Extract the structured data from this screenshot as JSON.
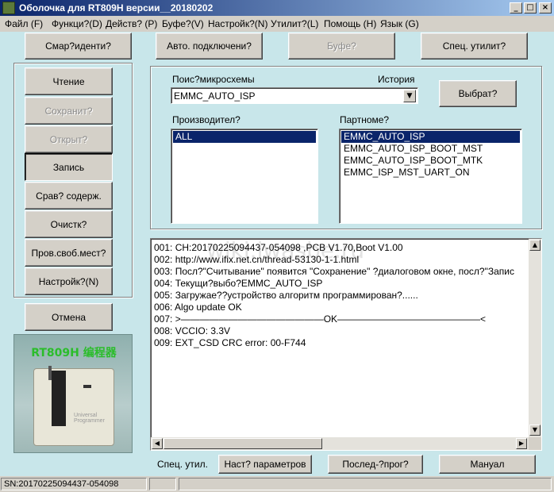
{
  "window": {
    "title": "Оболочка для RT809H версии__20180202",
    "min_symbol": "_",
    "max_symbol": "□",
    "close_symbol": "×"
  },
  "menu": [
    "Файл (F)",
    "Функци?(D)",
    "Действ? (P)",
    "Буфе?(V)",
    "Настройк?(N)",
    "Утилит?(L)",
    "Помощь (H)",
    "Язык (G)"
  ],
  "toolbar": {
    "smart_id": "Смар?иденти?",
    "auto_connect": "Авто. подключени?",
    "buffer": "Буфе?",
    "special_utils": "Спец. утилит?"
  },
  "side_buttons": {
    "read": "Чтение",
    "save": "Сохранит?",
    "open": "Открыт?",
    "write": "Запись",
    "compare": "Срав? содерж.",
    "erase": "Очистк?",
    "check_free": "Пров.своб.мест?",
    "settings": "Настройк?(N)",
    "cancel": "Отмена"
  },
  "device_image": {
    "label": "RT809H 编程器",
    "caption": "Universal Programmer"
  },
  "chip_panel": {
    "search_label": "Поис?микросхемы",
    "history_label": "История",
    "chip_value": "EMMC_AUTO_ISP",
    "select_button": "Выбрат?",
    "manufacturer_label": "Производител?",
    "manufacturers": [
      "ALL"
    ],
    "partnumber_label": "Партноме?",
    "partnumbers": [
      "EMMC_AUTO_ISP",
      "EMMC_AUTO_ISP_BOOT_MST",
      "EMMC_AUTO_ISP_BOOT_MTK",
      "EMMC_ISP_MST_UART_ON"
    ]
  },
  "log": [
    "001:  CH:20170225094437-054098  ,PCB V1.70,Boot V1.00",
    "002:  http://www.ifix.net.cn/thread-53130-1-1.html",
    "003:  Посл?\"Считывание\" появится \"Сохранение\" ?диалоговом окне, посл?\"Запис",
    "004:  Текущи?выбо?EMMC_AUTO_ISP",
    "005:  Загружае??устройство алгоритм программирован?......",
    "006:  Algo update OK",
    "007:  >———————————————OK———————————————<",
    "008:  VCCIO: 3.3V",
    "009:  EXT_CSD CRC error: 00-F744"
  ],
  "watermark": "wiki.iwasbe.ru",
  "bottom_bar": {
    "special_util_label": "Спец. утил.",
    "params_button": "Наст? параметров",
    "last_prog_button": "Послед-?прог?",
    "manual_button": "Мануал"
  },
  "status": {
    "serial": "SN:20170225094437-054098"
  }
}
